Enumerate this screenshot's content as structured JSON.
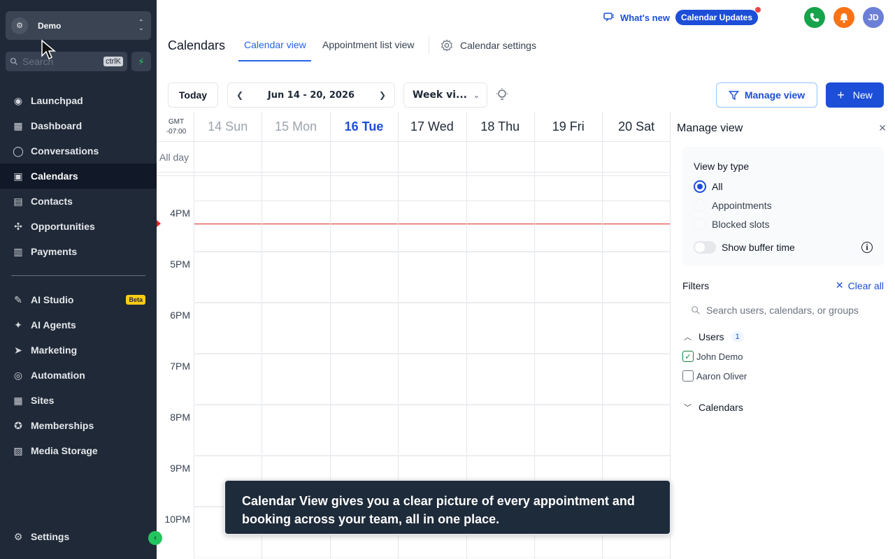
{
  "sidebar": {
    "account_name": "Demo",
    "search_placeholder": "Search",
    "search_shortcut": "ctrlK",
    "nav_main": [
      {
        "label": "Launchpad",
        "icon": "launchpad-icon",
        "active": false
      },
      {
        "label": "Dashboard",
        "icon": "dashboard-icon",
        "active": false
      },
      {
        "label": "Conversations",
        "icon": "chat-icon",
        "active": false
      },
      {
        "label": "Calendars",
        "icon": "calendar-icon",
        "active": true
      },
      {
        "label": "Contacts",
        "icon": "contacts-icon",
        "active": false
      },
      {
        "label": "Opportunities",
        "icon": "opportunities-icon",
        "active": false
      },
      {
        "label": "Payments",
        "icon": "payments-icon",
        "active": false
      }
    ],
    "nav_secondary": [
      {
        "label": "AI Studio",
        "icon": "ai-studio-icon",
        "badge": "Beta"
      },
      {
        "label": "AI Agents",
        "icon": "sparkle-icon"
      },
      {
        "label": "Marketing",
        "icon": "send-icon"
      },
      {
        "label": "Automation",
        "icon": "automation-icon"
      },
      {
        "label": "Sites",
        "icon": "sites-icon"
      },
      {
        "label": "Memberships",
        "icon": "membership-icon"
      },
      {
        "label": "Media Storage",
        "icon": "image-icon"
      }
    ],
    "settings_label": "Settings"
  },
  "topbar": {
    "whats_new": "What's new",
    "updates_pill": "Calendar Updates",
    "avatar_initials": "JD"
  },
  "header": {
    "title": "Calendars",
    "tabs": [
      "Calendar view",
      "Appointment list view"
    ],
    "settings_tab": "Calendar settings"
  },
  "toolbar": {
    "today": "Today",
    "date_range": "Jun 14 - 20, 2026",
    "view_select": "Week vi...",
    "manage_view": "Manage view",
    "new": "New"
  },
  "calendar": {
    "timezone_line1": "GMT",
    "timezone_line2": "-07:00",
    "all_day": "All day",
    "days": [
      {
        "label": "14 Sun",
        "state": "past"
      },
      {
        "label": "15 Mon",
        "state": "past"
      },
      {
        "label": "16 Tue",
        "state": "today"
      },
      {
        "label": "17 Wed",
        "state": "future"
      },
      {
        "label": "18 Thu",
        "state": "future"
      },
      {
        "label": "19 Fri",
        "state": "future"
      },
      {
        "label": "20 Sat",
        "state": "future"
      }
    ],
    "hours": [
      "4PM",
      "5PM",
      "6PM",
      "7PM",
      "8PM",
      "9PM",
      "10PM"
    ]
  },
  "manage_view": {
    "title": "Manage view",
    "view_by_type": "View by type",
    "types": [
      {
        "label": "All",
        "checked": true
      },
      {
        "label": "Appointments",
        "checked": false
      },
      {
        "label": "Blocked slots",
        "checked": false
      }
    ],
    "show_buffer_time": "Show buffer time",
    "filters_title": "Filters",
    "clear_all": "Clear all",
    "filter_search_placeholder": "Search users, calendars, or groups",
    "users_label": "Users",
    "users_count": "1",
    "users": [
      {
        "name": "John Demo",
        "checked": true
      },
      {
        "name": "Aaron Oliver",
        "checked": false
      }
    ],
    "calendars_label": "Calendars"
  },
  "tooltip": {
    "text": "Calendar View gives you a clear picture of every appointment and booking across your team, all in one place."
  },
  "colors": {
    "sidebar_bg": "#1f2937",
    "accent": "#1d4ed8",
    "now_line": "#dc2626"
  }
}
